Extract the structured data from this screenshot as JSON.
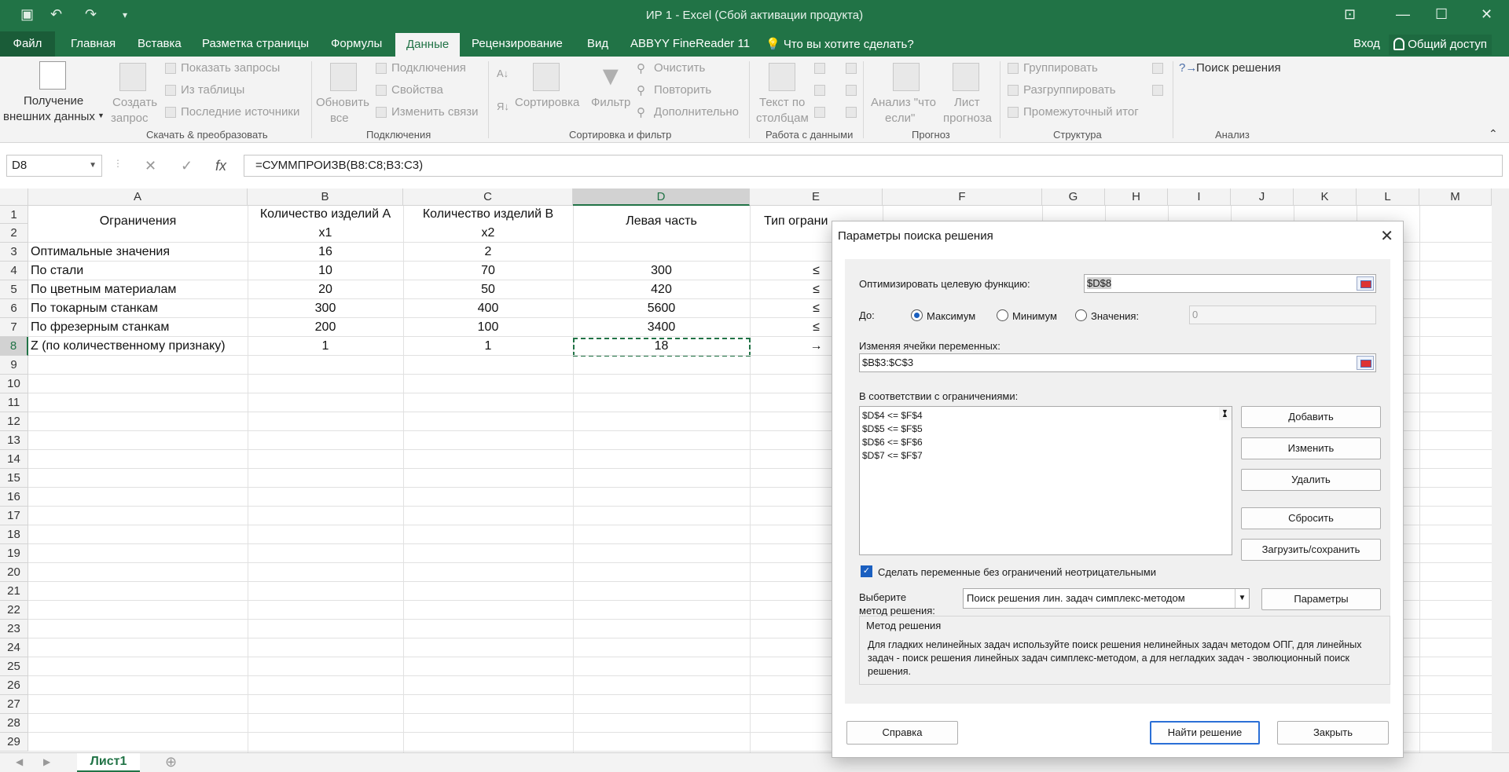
{
  "window": {
    "title": "ИР 1 - Excel (Сбой активации продукта)",
    "qa": {
      "save_icon": "save-icon",
      "undo_icon": "undo-icon",
      "redo_icon": "redo-icon",
      "customize_icon": "customize-qat-icon"
    }
  },
  "tabs": [
    "Файл",
    "Главная",
    "Вставка",
    "Разметка страницы",
    "Формулы",
    "Данные",
    "Рецензирование",
    "Вид",
    "ABBYY FineReader 11"
  ],
  "tell_me": "Что вы хотите сделать?",
  "signin": "Вход",
  "share": "Общий доступ",
  "ribbon": {
    "get_external": [
      "Получение",
      "внешних данных"
    ],
    "create_query": [
      "Создать",
      "запрос"
    ],
    "show_queries": "Показать запросы",
    "from_table": "Из таблицы",
    "recent_sources": "Последние источники",
    "group_get": "Скачать & преобразовать",
    "refresh_all": [
      "Обновить",
      "все"
    ],
    "connections": "Подключения",
    "properties": "Свойства",
    "edit_links": "Изменить связи",
    "group_connections": "Подключения",
    "sort": "Сортировка",
    "filter": "Фильтр",
    "clear": "Очистить",
    "reapply": "Повторить",
    "advanced": "Дополнительно",
    "group_sort": "Сортировка и фильтр",
    "text_to_columns": [
      "Текст по",
      "столбцам"
    ],
    "group_data_tools": "Работа с данными",
    "what_if": [
      "Анализ \"что",
      "если\""
    ],
    "forecast_sheet": [
      "Лист",
      "прогноза"
    ],
    "group_forecast": "Прогноз",
    "group_btn": "Группировать",
    "ungroup_btn": "Разгруппировать",
    "subtotal": "Промежуточный итог",
    "group_outline": "Структура",
    "solver": "Поиск решения",
    "group_analysis": "Анализ"
  },
  "formula_bar": {
    "name_box": "D8",
    "cancel": "✕",
    "enter": "✓",
    "fx": "fx",
    "formula": "=СУММПРОИЗВ(B8:C8;B3:C3)"
  },
  "columns": [
    "A",
    "B",
    "C",
    "D",
    "E",
    "F",
    "G",
    "H",
    "I",
    "J",
    "K",
    "L",
    "M"
  ],
  "rows": [
    "1",
    "2",
    "3",
    "4",
    "5",
    "6",
    "7",
    "8",
    "9",
    "10",
    "11",
    "12",
    "13",
    "14",
    "15",
    "16",
    "17",
    "18",
    "19",
    "20",
    "21",
    "22",
    "23",
    "24",
    "25",
    "26",
    "27",
    "28",
    "29"
  ],
  "sheet": {
    "a1": "Ограничения",
    "b1": "Количество изделий А",
    "c1": "Количество изделий В",
    "d1": "Левая часть",
    "e1": "Тип ограни",
    "b2": "x1",
    "c2": "x2",
    "r3": {
      "a": "Оптимальные значения",
      "b": "16",
      "c": "2",
      "d": "",
      "e": ""
    },
    "r4": {
      "a": "По стали",
      "b": "10",
      "c": "70",
      "d": "300",
      "e": "≤"
    },
    "r5": {
      "a": "По цветным материалам",
      "b": "20",
      "c": "50",
      "d": "420",
      "e": "≤"
    },
    "r6": {
      "a": "По токарным станкам",
      "b": "300",
      "c": "400",
      "d": "5600",
      "e": "≤"
    },
    "r7": {
      "a": "По фрезерным станкам",
      "b": "200",
      "c": "100",
      "d": "3400",
      "e": "≤"
    },
    "r8": {
      "a": "Z (по количественному признаку)",
      "b": "1",
      "c": "1",
      "d": "18",
      "e": "→"
    }
  },
  "sheet_tab": "Лист1",
  "dialog": {
    "title": "Параметры поиска решения",
    "objective_label": "Оптимизировать целевую функцию:",
    "objective_value": "$D$8",
    "to_label": "До:",
    "max": "Максимум",
    "min": "Минимум",
    "value_of": "Значения:",
    "value_field": "0",
    "changing_label": "Изменяя ячейки переменных:",
    "changing_value": "$B$3:$C$3",
    "constraints_label": "В соответствии с ограничениями:",
    "constraints": [
      "$D$4 <= $F$4",
      "$D$5 <= $F$5",
      "$D$6 <= $F$6",
      "$D$7 <= $F$7"
    ],
    "add": "Добавить",
    "change": "Изменить",
    "delete": "Удалить",
    "reset": "Сбросить",
    "load_save": "Загрузить/сохранить",
    "nonneg": "Сделать переменные без ограничений неотрицательными",
    "method_label_1": "Выберите",
    "method_label_2": "метод решения:",
    "method_value": "Поиск решения лин. задач симплекс-методом",
    "options": "Параметры",
    "method_group": "Метод решения",
    "method_desc": "Для гладких нелинейных задач используйте поиск решения нелинейных задач методом ОПГ, для линейных задач - поиск решения линейных задач симплекс-методом, а для негладких задач - эволюционный поиск решения.",
    "help": "Справка",
    "solve": "Найти решение",
    "close": "Закрыть"
  },
  "colors": {
    "accent": "#217346",
    "primary_blue": "#2a6fd6"
  }
}
